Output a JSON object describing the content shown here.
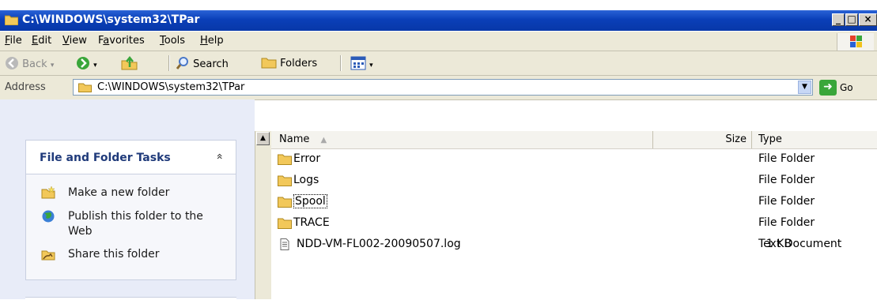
{
  "window": {
    "title": "C:\\WINDOWS\\system32\\TPar",
    "buttons": {
      "minimize": "_",
      "maximize": "□",
      "close": "×"
    }
  },
  "menubar": {
    "items": [
      {
        "label": "File",
        "hotkey": "F"
      },
      {
        "label": "Edit",
        "hotkey": "E"
      },
      {
        "label": "View",
        "hotkey": "V"
      },
      {
        "label": "Favorites",
        "hotkey": "a"
      },
      {
        "label": "Tools",
        "hotkey": "T"
      },
      {
        "label": "Help",
        "hotkey": "H"
      }
    ]
  },
  "toolbar": {
    "back_label": "Back",
    "search_label": "Search",
    "folders_label": "Folders"
  },
  "address": {
    "label": "Address",
    "value": "C:\\WINDOWS\\system32\\TPar",
    "go_label": "Go"
  },
  "tasks": {
    "title": "File and Folder Tasks",
    "collapse_glyph": "«",
    "items": [
      {
        "label": "Make a new folder",
        "icon": "new-folder-icon"
      },
      {
        "label": "Publish this folder to the Web",
        "icon": "publish-web-icon"
      },
      {
        "label": "Share this folder",
        "icon": "share-folder-icon"
      }
    ]
  },
  "columns": {
    "name": "Name",
    "size": "Size",
    "type": "Type"
  },
  "files": [
    {
      "name": "Error",
      "size": "",
      "type": "File Folder",
      "icon": "folder-icon"
    },
    {
      "name": "Logs",
      "size": "",
      "type": "File Folder",
      "icon": "folder-icon"
    },
    {
      "name": "Spool",
      "size": "",
      "type": "File Folder",
      "icon": "folder-icon",
      "focused": true
    },
    {
      "name": "TRACE",
      "size": "",
      "type": "File Folder",
      "icon": "folder-icon"
    },
    {
      "name": "NDD-VM-FL002-20090507.log",
      "size": "1 KB",
      "type": "Text Document",
      "icon": "text-document-icon"
    }
  ],
  "colors": {
    "title_bar": "#0a3fb8",
    "chrome": "#ece9d8",
    "task_pane": "#e8ecf8",
    "folder": "#f2c85a"
  }
}
